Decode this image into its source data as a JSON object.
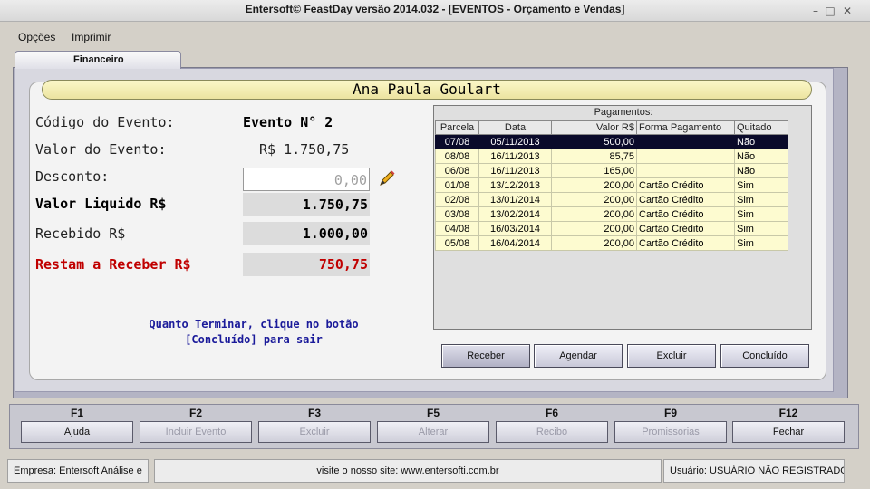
{
  "window": {
    "title": "Entersoft© FeastDay versão 2014.032 - [EVENTOS - Orçamento e Vendas]"
  },
  "menu": {
    "items": [
      "Opções",
      "Imprimir"
    ]
  },
  "tab": {
    "label": "Financeiro"
  },
  "client": {
    "name": "Ana Paula Goulart"
  },
  "fields": {
    "codigo_label": "Código do Evento:",
    "codigo_value": "Evento N° 2",
    "valor_label": "Valor do Evento:",
    "valor_value": "R$ 1.750,75",
    "desconto_label": "Desconto:",
    "desconto_value": "0,00",
    "liquido_label": "Valor Liquido R$",
    "liquido_value": "1.750,75",
    "recebido_label": "Recebido R$",
    "recebido_value": "1.000,00",
    "restam_label": "Restam a Receber R$",
    "restam_value": "750,75"
  },
  "hint": {
    "line1": "Quanto Terminar, clique no botão",
    "line2": "[Concluído] para sair"
  },
  "payments": {
    "title": "Pagamentos:",
    "columns": [
      "Parcela",
      "Data",
      "Valor R$",
      "Forma Pagamento",
      "Quitado"
    ],
    "rows": [
      [
        "07/08",
        "05/11/2013",
        "500,00",
        "",
        "Não"
      ],
      [
        "08/08",
        "16/11/2013",
        "85,75",
        "",
        "Não"
      ],
      [
        "06/08",
        "16/11/2013",
        "165,00",
        "",
        "Não"
      ],
      [
        "01/08",
        "13/12/2013",
        "200,00",
        "Cartão Crédito",
        "Sim"
      ],
      [
        "02/08",
        "13/01/2014",
        "200,00",
        "Cartão Crédito",
        "Sim"
      ],
      [
        "03/08",
        "13/02/2014",
        "200,00",
        "Cartão Crédito",
        "Sim"
      ],
      [
        "04/08",
        "16/03/2014",
        "200,00",
        "Cartão Crédito",
        "Sim"
      ],
      [
        "05/08",
        "16/04/2014",
        "200,00",
        "Cartão Crédito",
        "Sim"
      ]
    ],
    "selected_row": 0
  },
  "actions": {
    "receber": "Receber",
    "agendar": "Agendar",
    "excluir": "Excluir",
    "concluido": "Concluído"
  },
  "fkeys": [
    {
      "key": "F1",
      "label": "Ajuda",
      "enabled": true
    },
    {
      "key": "F2",
      "label": "Incluir Evento",
      "enabled": false
    },
    {
      "key": "F3",
      "label": "Excluir",
      "enabled": false
    },
    {
      "key": "F5",
      "label": "Alterar",
      "enabled": false
    },
    {
      "key": "F6",
      "label": "Recibo",
      "enabled": false
    },
    {
      "key": "F9",
      "label": "Promissorias",
      "enabled": false
    },
    {
      "key": "F12",
      "label": "Fechar",
      "enabled": true
    }
  ],
  "status": {
    "empresa": "Empresa: Entersoft Análise e",
    "site": "visite o nosso site: www.entersofti.com.br",
    "usuario": "Usuário: USUÁRIO NÃO REGISTRADO"
  },
  "colors": {
    "accent_red": "#c00000",
    "hint_blue": "#1a1a9a",
    "grid_row": "#fdfbd0",
    "grid_selected": "#0a0a2a"
  }
}
